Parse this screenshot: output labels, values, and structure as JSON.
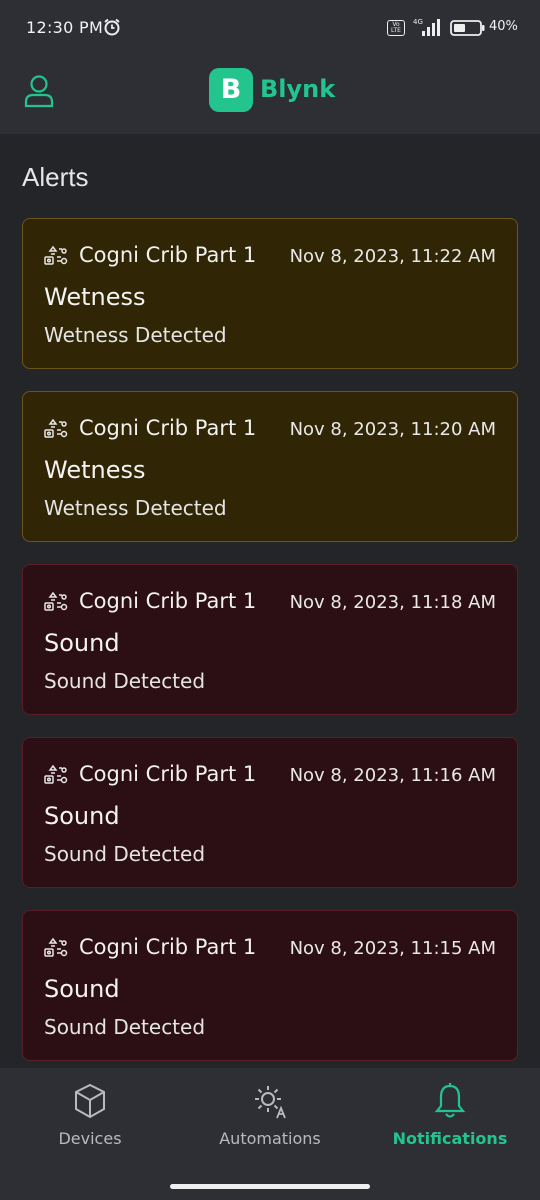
{
  "status_bar": {
    "time": "12:30 PM",
    "network": "4G",
    "volte": "Vo LTE",
    "battery": "40%"
  },
  "header": {
    "logo_letter": "B",
    "app_name": "Blynk"
  },
  "page_title": "Alerts",
  "alerts": [
    {
      "type": "wetness",
      "device": "Cogni Crib Part 1",
      "time": "Nov 8, 2023, 11:22 AM",
      "title": "Wetness",
      "message": "Wetness Detected"
    },
    {
      "type": "wetness",
      "device": "Cogni Crib Part 1",
      "time": "Nov 8, 2023, 11:20 AM",
      "title": "Wetness",
      "message": "Wetness Detected"
    },
    {
      "type": "sound",
      "device": "Cogni Crib Part 1",
      "time": "Nov 8, 2023, 11:18 AM",
      "title": "Sound",
      "message": "Sound Detected"
    },
    {
      "type": "sound",
      "device": "Cogni Crib Part 1",
      "time": "Nov 8, 2023, 11:16 AM",
      "title": "Sound",
      "message": "Sound Detected"
    },
    {
      "type": "sound",
      "device": "Cogni Crib Part 1",
      "time": "Nov 8, 2023, 11:15 AM",
      "title": "Sound",
      "message": "Sound Detected"
    }
  ],
  "nav": [
    {
      "label": "Devices",
      "icon": "cube-icon",
      "active": false
    },
    {
      "label": "Automations",
      "icon": "sun-a-icon",
      "active": false
    },
    {
      "label": "Notifications",
      "icon": "bell-icon",
      "active": true
    }
  ],
  "colors": {
    "accent": "#23c48e",
    "wetness_card": "#302605",
    "sound_card": "#2c0f14",
    "background": "#232529"
  }
}
